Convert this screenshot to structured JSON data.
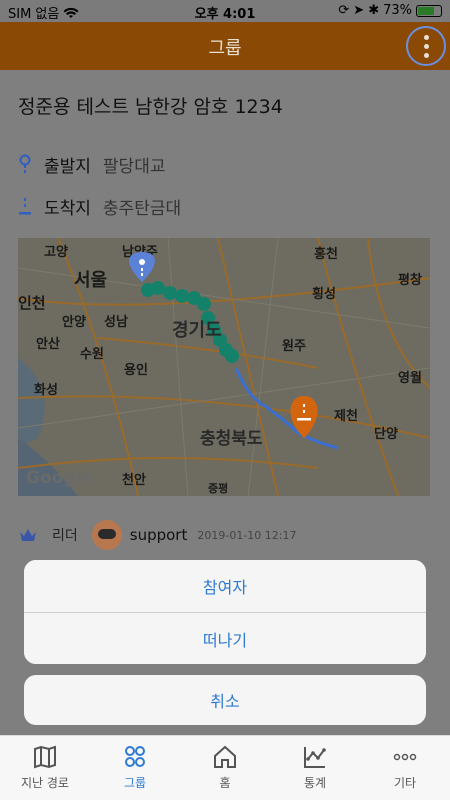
{
  "status_bar": {
    "carrier": "SIM 없음",
    "time": "오후 4:01",
    "battery_percent": "73%",
    "battery_level": 0.73
  },
  "nav": {
    "title": "그룹",
    "more_icon": "more-vertical-icon"
  },
  "group": {
    "title": "정준용 테스트 남한강 암호 1234",
    "departure_label": "출발지",
    "departure_value": "팔당대교",
    "arrival_label": "도착지",
    "arrival_value": "충주탄금대"
  },
  "map": {
    "provider_logo": "Google",
    "place_labels": [
      "고양",
      "남양주",
      "서울",
      "인천",
      "안양",
      "성남",
      "안산",
      "수원",
      "용인",
      "화성",
      "경기도",
      "충청북도",
      "천안",
      "증평",
      "홍천",
      "평창",
      "횡성",
      "원주",
      "영월",
      "제천",
      "단양"
    ],
    "colors": {
      "route_done": "#14826a",
      "route_remaining": "#3a6fd1",
      "start_pin": "#5b82d6",
      "end_pin": "#d2650d"
    }
  },
  "leader": {
    "role_label": "리더",
    "name": "support",
    "date": "2019-01-10 12:17"
  },
  "action_sheet": {
    "participants": "참여자",
    "leave": "떠나기",
    "cancel": "취소"
  },
  "tabs": [
    {
      "label": "지난 경로",
      "icon": "map-icon"
    },
    {
      "label": "그룹",
      "icon": "group-icon"
    },
    {
      "label": "홈",
      "icon": "home-icon"
    },
    {
      "label": "통계",
      "icon": "stats-icon"
    },
    {
      "label": "기타",
      "icon": "more-horizontal-icon"
    }
  ],
  "accent_color": "#2f7ad1",
  "nav_color": "#8a4a05"
}
